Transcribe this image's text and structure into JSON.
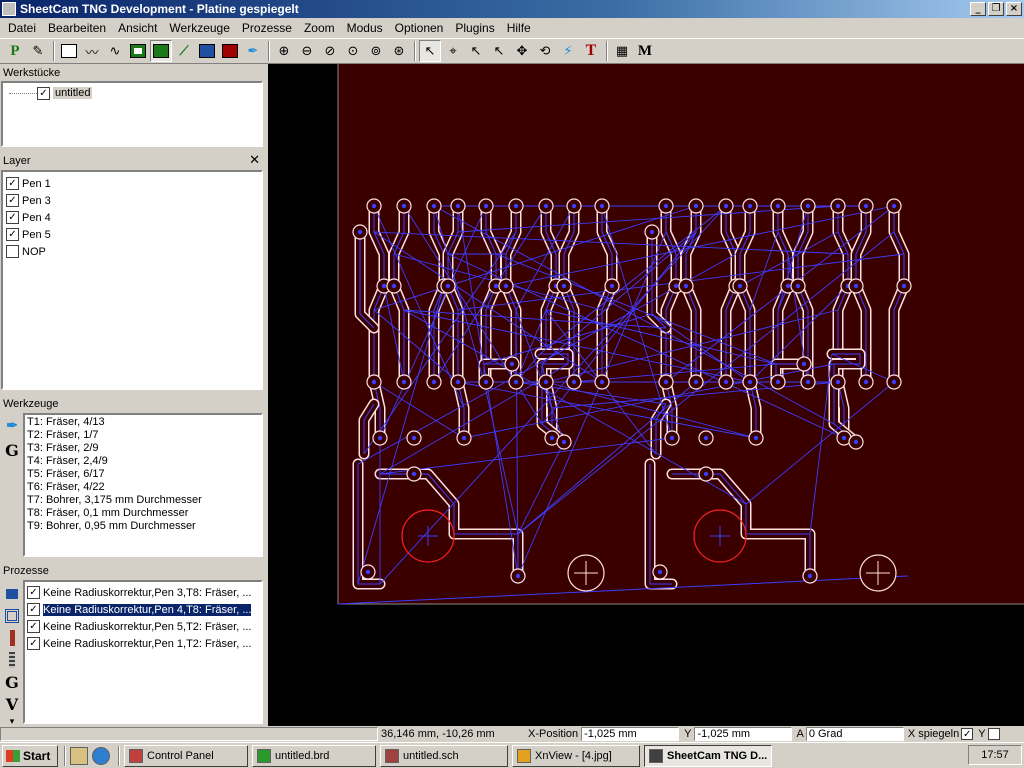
{
  "window": {
    "title": "SheetCam TNG Development - Platine gespiegelt"
  },
  "menu": [
    "Datei",
    "Bearbeiten",
    "Ansicht",
    "Werkzeuge",
    "Prozesse",
    "Zoom",
    "Modus",
    "Optionen",
    "Plugins",
    "Hilfe"
  ],
  "toolbar": {
    "text_tool_label": "T",
    "macro_tool_label": "M",
    "p_label": "P"
  },
  "werkstuecke": {
    "title": "Werkstücke",
    "item": "untitled",
    "checked": true
  },
  "layer": {
    "title": "Layer",
    "items": [
      {
        "label": "Pen 1",
        "checked": true
      },
      {
        "label": "Pen 3",
        "checked": true
      },
      {
        "label": "Pen 4",
        "checked": true
      },
      {
        "label": "Pen 5",
        "checked": true
      },
      {
        "label": "NOP",
        "checked": false
      }
    ]
  },
  "werkzeuge": {
    "title": "Werkzeuge",
    "items": [
      "T1: Fräser, 4/13",
      "T2: Fräser, 1/7",
      "T3: Fräser, 2/9",
      "T4: Fräser, 2,4/9",
      "T5: Fräser, 6/17",
      "T6: Fräser, 4/22",
      "T7: Bohrer, 3,175 mm Durchmesser",
      "T8: Fräser, 0,1 mm Durchmesser",
      "T9: Bohrer, 0,95 mm Durchmesser"
    ],
    "g_label": "G"
  },
  "prozesse": {
    "title": "Prozesse",
    "items": [
      {
        "label": "Keine Radiuskorrektur,Pen 3,T8: Fräser, ...",
        "checked": true,
        "selected": false
      },
      {
        "label": "Keine Radiuskorrektur,Pen 4,T8: Fräser, ...",
        "checked": true,
        "selected": true
      },
      {
        "label": "Keine Radiuskorrektur,Pen 5,T2: Fräser, ...",
        "checked": true,
        "selected": false
      },
      {
        "label": "Keine Radiuskorrektur,Pen 1,T2: Fräser, ...",
        "checked": true,
        "selected": false
      }
    ],
    "g_label": "G",
    "v_label": "V"
  },
  "status": {
    "coords": "36,146 mm, -10,26 mm",
    "xpos_label": "X-Position",
    "xpos_value": "-1,025 mm",
    "y_label": "Y",
    "y_value": "-1,025 mm",
    "a_label": "A",
    "a_value": "0 Grad",
    "x_mirror_label": "X spiegeln",
    "x_mirror_checked": true,
    "y_mirror_label": "Y",
    "y_mirror_checked": false
  },
  "taskbar": {
    "start": "Start",
    "buttons": [
      {
        "label": "Control Panel",
        "active": false
      },
      {
        "label": "untitled.brd",
        "active": false
      },
      {
        "label": "untitled.sch",
        "active": false
      },
      {
        "label": "XnView - [4.jpg]",
        "active": false
      },
      {
        "label": "SheetCam TNG D...",
        "active": true
      }
    ],
    "clock": "17:57"
  },
  "colors": {
    "board": "#3a0000",
    "trace_outline": "#ffe0e0",
    "toolpath": "#3c3cff",
    "drill": "#ff2020",
    "canvas": "#000000",
    "selection": "#0a246a"
  }
}
